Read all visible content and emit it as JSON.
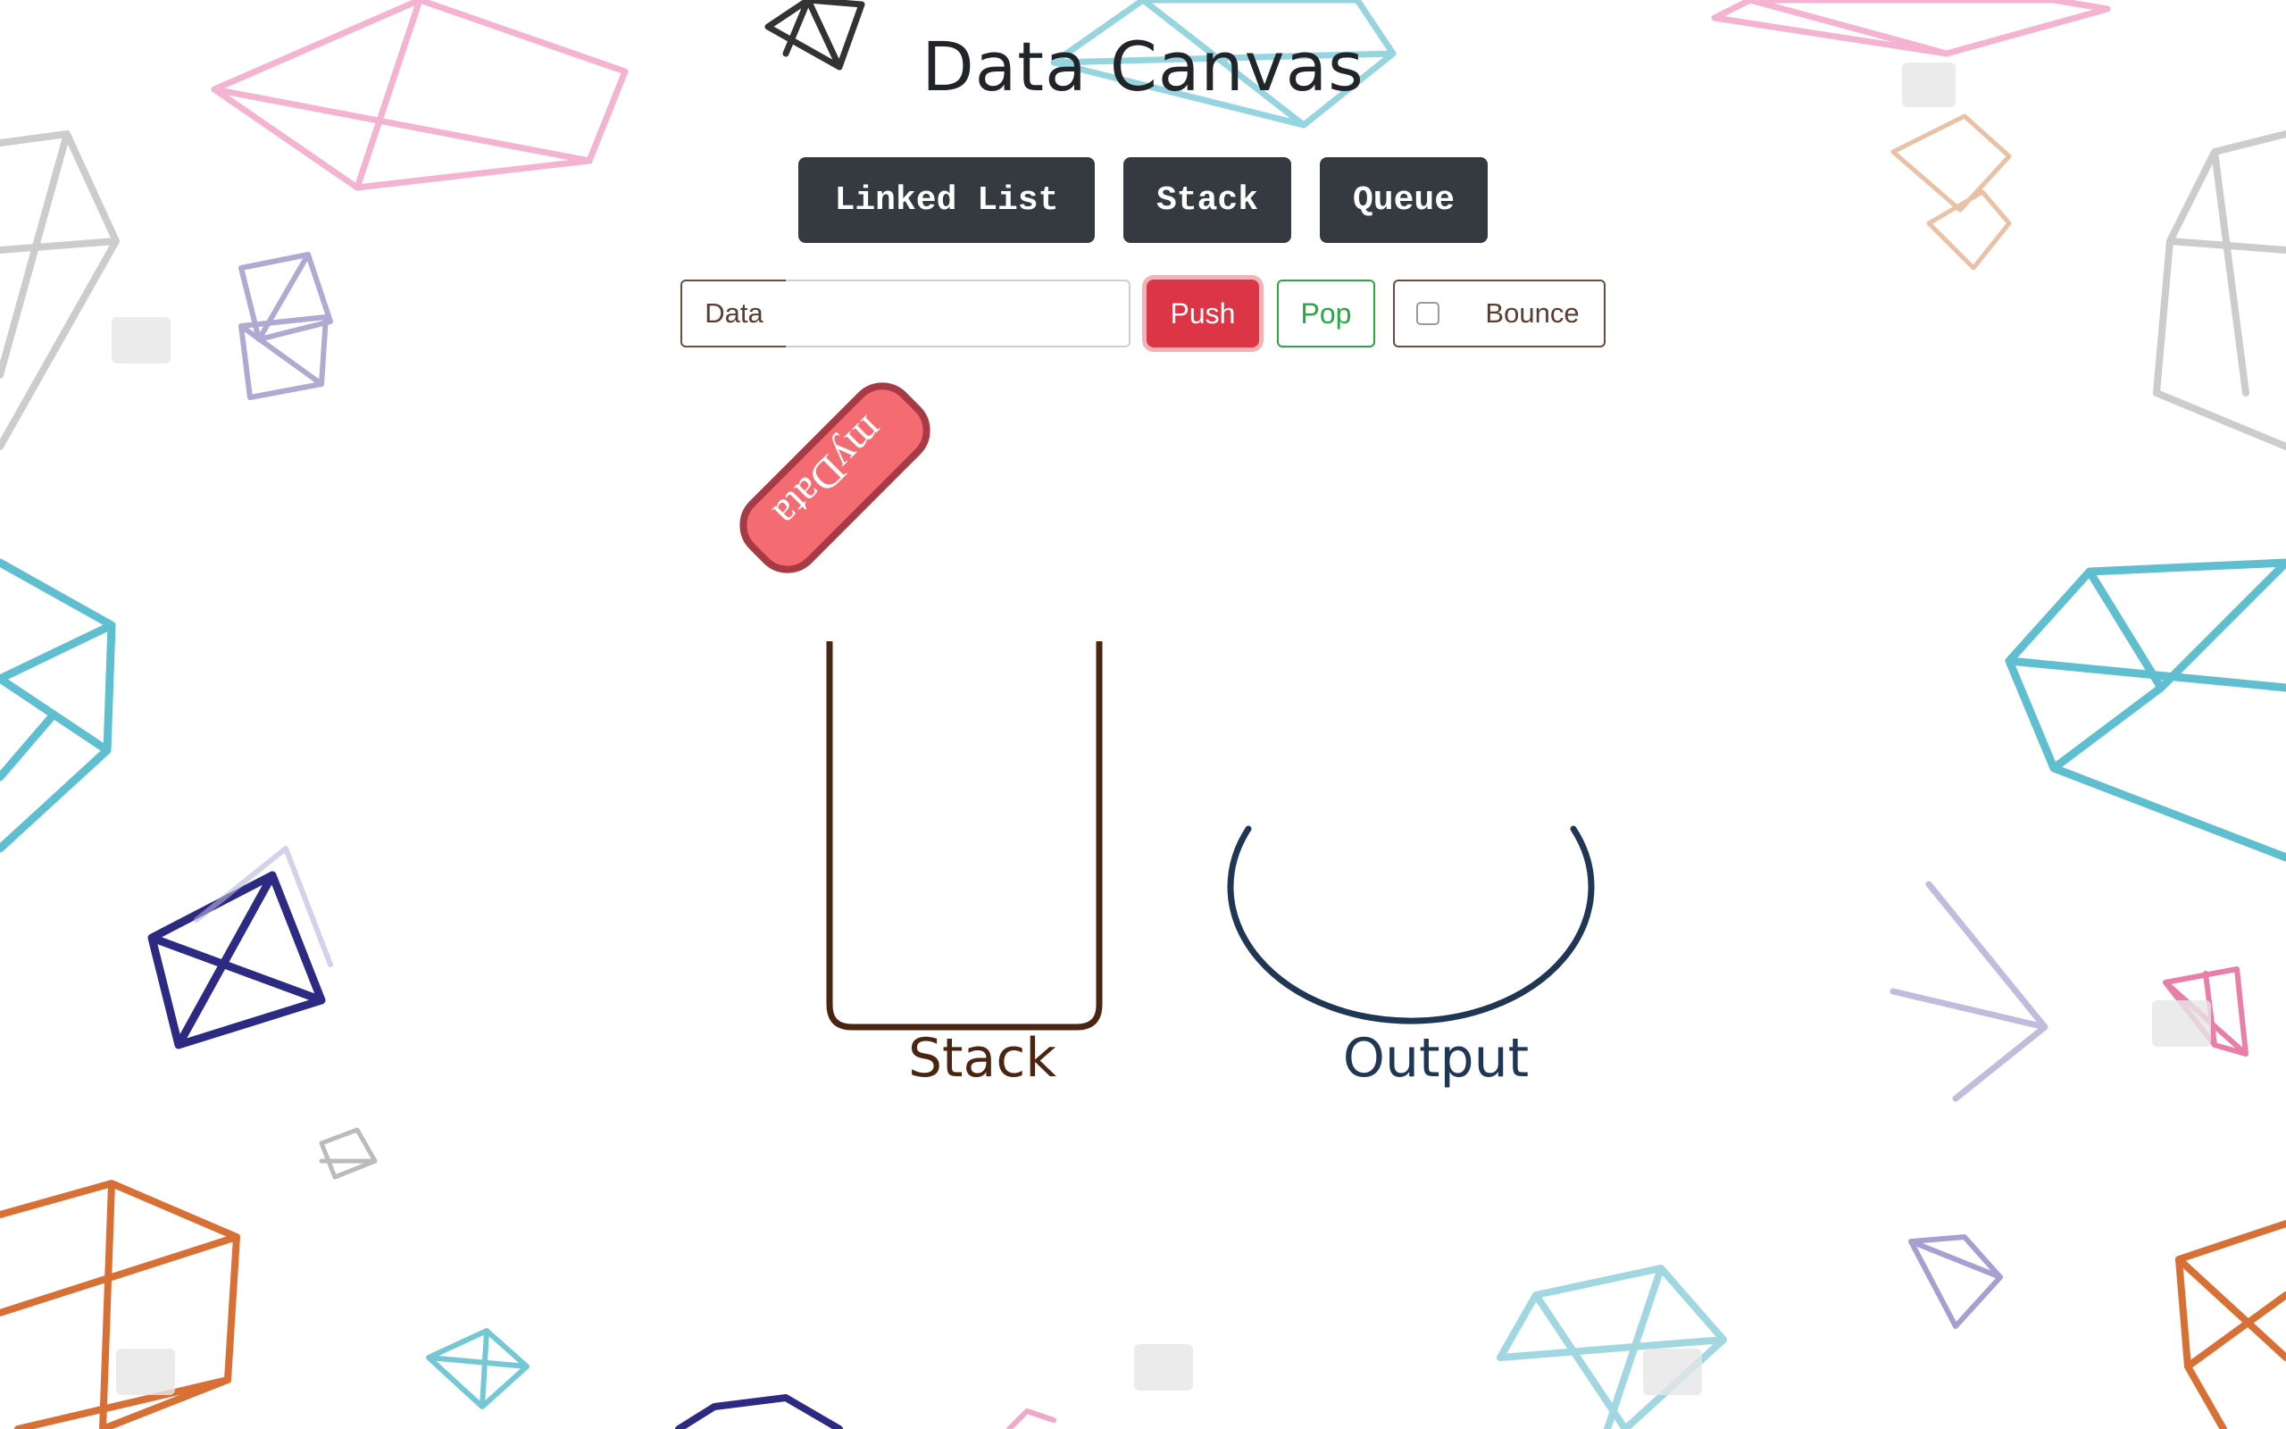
{
  "app": {
    "title": "Data Canvas"
  },
  "nav": {
    "linked_list": "Linked List",
    "stack": "Stack",
    "queue": "Queue"
  },
  "controls": {
    "data_label": "Data",
    "data_value": "",
    "push_label": "Push",
    "pop_label": "Pop",
    "bounce_label": "Bounce",
    "bounce_checked": false
  },
  "canvas": {
    "floating_item": "myData",
    "stack_label": "Stack",
    "output_label": "Output"
  },
  "colors": {
    "nav_button": "#343a40",
    "push": "#dc3545",
    "pop": "#28a745",
    "stack": "#4a2511",
    "output": "#1f3655",
    "item_fill": "#f56b72",
    "item_stroke": "#a73a45"
  },
  "background": {
    "decoration": "geometric-gem-outlines",
    "watermark": "shutterstock"
  }
}
